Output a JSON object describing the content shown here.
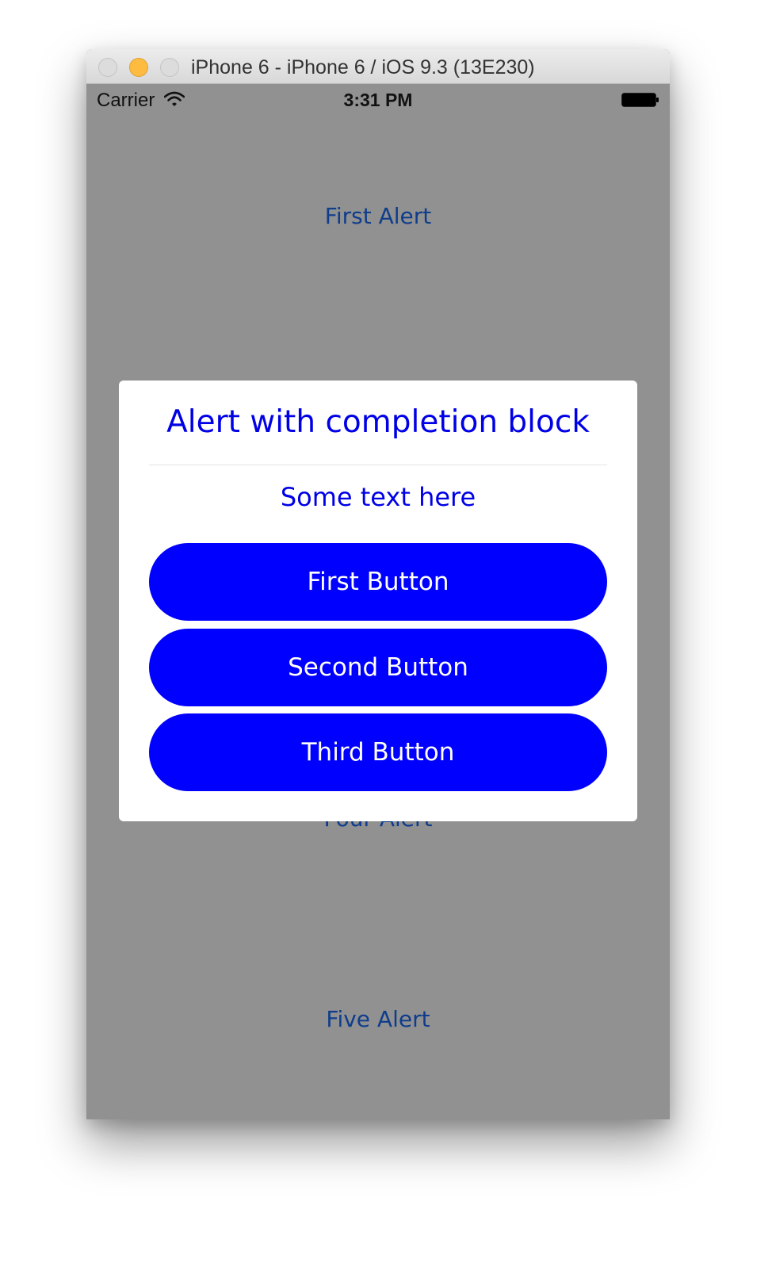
{
  "window": {
    "title": "iPhone 6 - iPhone 6 / iOS 9.3 (13E230)"
  },
  "statusbar": {
    "carrier": "Carrier",
    "time": "3:31 PM",
    "wifi_icon": "wifi-icon",
    "battery_icon": "battery-icon"
  },
  "background_links": {
    "first": "First Alert",
    "four": "Four Alert",
    "five": "Five Alert"
  },
  "alert": {
    "title": "Alert with completion block",
    "message": "Some text here",
    "buttons": [
      "First Button",
      "Second Button",
      "Third Button"
    ]
  },
  "colors": {
    "accent": "#0000ff",
    "background_link": "#0e3d8c",
    "overlay": "#919191",
    "minimize_light": "#fdbc40"
  }
}
